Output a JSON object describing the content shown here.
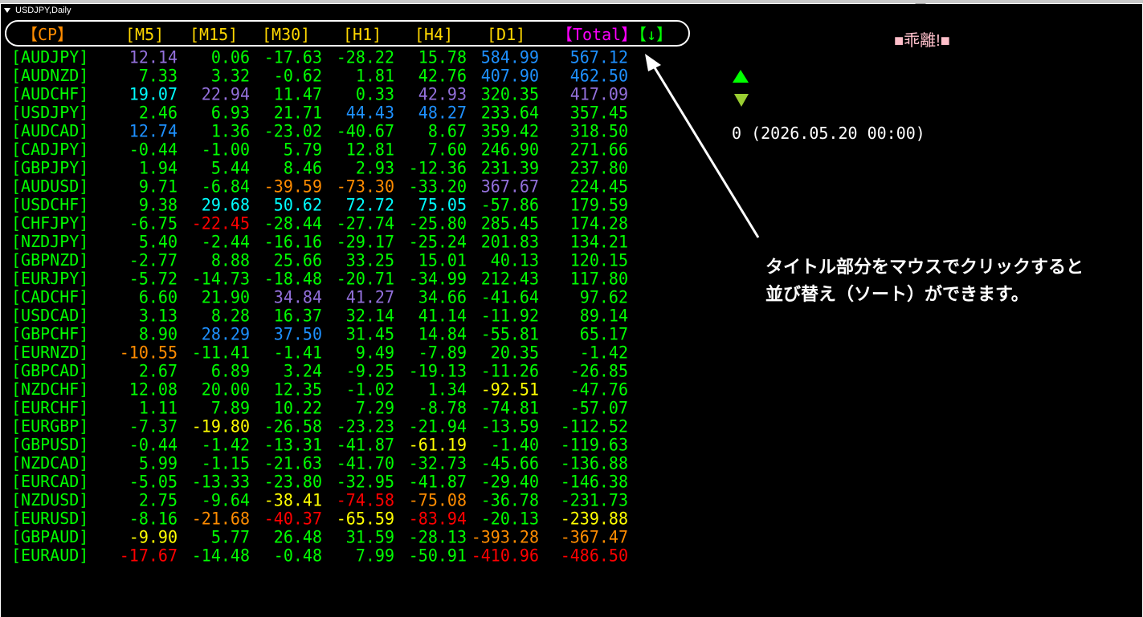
{
  "window_title": "USDJPY,Daily",
  "headers": [
    {
      "label": "【CP】",
      "color": "#ff8c00"
    },
    {
      "label": "[M5]",
      "color": "#ffd700"
    },
    {
      "label": "[M15]",
      "color": "#ffd700"
    },
    {
      "label": "[M30]",
      "color": "#ffd700"
    },
    {
      "label": "[H1]",
      "color": "#ffd700"
    },
    {
      "label": "[H4]",
      "color": "#ffd700"
    },
    {
      "label": "[D1]",
      "color": "#ffd700"
    },
    {
      "label": "【Total】",
      "color": "#ff00ff"
    },
    {
      "label": "【↓】",
      "color": "#00ff00"
    }
  ],
  "kairi_label": "■乖離!■",
  "status_text": "0 (2026.05.20 00:00)",
  "annotation": {
    "line1": "タイトル部分をマウスでクリックすると",
    "line2": "並び替え（ソート）ができます。"
  },
  "colors": {
    "pair": "#00ff00",
    "normal": "#00ff00",
    "purple": "#9370db",
    "cyan": "#1e90ff",
    "aqua": "#00ffff",
    "orange": "#ff8c00",
    "yellow": "#ffff00",
    "red": "#ff0000",
    "lightblue": "#87cefa"
  },
  "rows": [
    {
      "pair": "[AUDJPY]",
      "v": [
        "12.14",
        "0.06",
        "-17.63",
        "-28.22",
        "15.78",
        "584.99",
        "567.12"
      ],
      "c": [
        "purple",
        "normal",
        "normal",
        "normal",
        "normal",
        "cyan",
        "cyan"
      ]
    },
    {
      "pair": "[AUDNZD]",
      "v": [
        "7.33",
        "3.32",
        "-0.62",
        "1.81",
        "42.76",
        "407.90",
        "462.50"
      ],
      "c": [
        "normal",
        "normal",
        "normal",
        "normal",
        "normal",
        "cyan",
        "cyan"
      ]
    },
    {
      "pair": "[AUDCHF]",
      "v": [
        "19.07",
        "22.94",
        "11.47",
        "0.33",
        "42.93",
        "320.35",
        "417.09"
      ],
      "c": [
        "aqua",
        "purple",
        "normal",
        "normal",
        "purple",
        "normal",
        "purple"
      ]
    },
    {
      "pair": "[USDJPY]",
      "v": [
        "2.46",
        "6.93",
        "21.71",
        "44.43",
        "48.27",
        "233.64",
        "357.45"
      ],
      "c": [
        "normal",
        "normal",
        "normal",
        "cyan",
        "cyan",
        "normal",
        "normal"
      ]
    },
    {
      "pair": "[AUDCAD]",
      "v": [
        "12.74",
        "1.36",
        "-23.02",
        "-40.67",
        "8.67",
        "359.42",
        "318.50"
      ],
      "c": [
        "cyan",
        "normal",
        "normal",
        "normal",
        "normal",
        "normal",
        "normal"
      ]
    },
    {
      "pair": "[CADJPY]",
      "v": [
        "-0.44",
        "-1.00",
        "5.79",
        "12.81",
        "7.60",
        "246.90",
        "271.66"
      ],
      "c": [
        "normal",
        "normal",
        "normal",
        "normal",
        "normal",
        "normal",
        "normal"
      ]
    },
    {
      "pair": "[GBPJPY]",
      "v": [
        "1.94",
        "5.44",
        "8.46",
        "2.93",
        "-12.36",
        "231.39",
        "237.80"
      ],
      "c": [
        "normal",
        "normal",
        "normal",
        "normal",
        "normal",
        "normal",
        "normal"
      ]
    },
    {
      "pair": "[AUDUSD]",
      "v": [
        "9.71",
        "-6.84",
        "-39.59",
        "-73.30",
        "-33.20",
        "367.67",
        "224.45"
      ],
      "c": [
        "normal",
        "normal",
        "orange",
        "orange",
        "normal",
        "purple",
        "normal"
      ]
    },
    {
      "pair": "[USDCHF]",
      "v": [
        "9.38",
        "29.68",
        "50.62",
        "72.72",
        "75.05",
        "-57.86",
        "179.59"
      ],
      "c": [
        "normal",
        "aqua",
        "aqua",
        "aqua",
        "aqua",
        "normal",
        "normal"
      ]
    },
    {
      "pair": "[CHFJPY]",
      "v": [
        "-6.75",
        "-22.45",
        "-28.44",
        "-27.74",
        "-25.80",
        "285.45",
        "174.28"
      ],
      "c": [
        "normal",
        "red",
        "normal",
        "normal",
        "normal",
        "normal",
        "normal"
      ]
    },
    {
      "pair": "[NZDJPY]",
      "v": [
        "5.40",
        "-2.44",
        "-16.16",
        "-29.17",
        "-25.24",
        "201.83",
        "134.21"
      ],
      "c": [
        "normal",
        "normal",
        "normal",
        "normal",
        "normal",
        "normal",
        "normal"
      ]
    },
    {
      "pair": "[GBPNZD]",
      "v": [
        "-2.77",
        "8.88",
        "25.66",
        "33.25",
        "15.01",
        "40.13",
        "120.15"
      ],
      "c": [
        "normal",
        "normal",
        "normal",
        "normal",
        "normal",
        "normal",
        "normal"
      ]
    },
    {
      "pair": "[EURJPY]",
      "v": [
        "-5.72",
        "-14.73",
        "-18.48",
        "-20.71",
        "-34.99",
        "212.43",
        "117.80"
      ],
      "c": [
        "normal",
        "normal",
        "normal",
        "normal",
        "normal",
        "normal",
        "normal"
      ]
    },
    {
      "pair": "[CADCHF]",
      "v": [
        "6.60",
        "21.90",
        "34.84",
        "41.27",
        "34.66",
        "-41.64",
        "97.62"
      ],
      "c": [
        "normal",
        "normal",
        "purple",
        "purple",
        "normal",
        "normal",
        "normal"
      ]
    },
    {
      "pair": "[USDCAD]",
      "v": [
        "3.13",
        "8.28",
        "16.37",
        "32.14",
        "41.14",
        "-11.92",
        "89.14"
      ],
      "c": [
        "normal",
        "normal",
        "normal",
        "normal",
        "normal",
        "normal",
        "normal"
      ]
    },
    {
      "pair": "[GBPCHF]",
      "v": [
        "8.90",
        "28.29",
        "37.50",
        "31.45",
        "14.84",
        "-55.81",
        "65.17"
      ],
      "c": [
        "normal",
        "cyan",
        "cyan",
        "normal",
        "normal",
        "normal",
        "normal"
      ]
    },
    {
      "pair": "[EURNZD]",
      "v": [
        "-10.55",
        "-11.41",
        "-1.41",
        "9.49",
        "-7.89",
        "20.35",
        "-1.42"
      ],
      "c": [
        "orange",
        "normal",
        "normal",
        "normal",
        "normal",
        "normal",
        "normal"
      ]
    },
    {
      "pair": "[GBPCAD]",
      "v": [
        "2.67",
        "6.89",
        "3.24",
        "-9.25",
        "-19.13",
        "-11.26",
        "-26.85"
      ],
      "c": [
        "normal",
        "normal",
        "normal",
        "normal",
        "normal",
        "normal",
        "normal"
      ]
    },
    {
      "pair": "[NZDCHF]",
      "v": [
        "12.08",
        "20.00",
        "12.35",
        "-1.02",
        "1.34",
        "-92.51",
        "-47.76"
      ],
      "c": [
        "normal",
        "normal",
        "normal",
        "normal",
        "normal",
        "yellow",
        "normal"
      ]
    },
    {
      "pair": "[EURCHF]",
      "v": [
        "1.11",
        "7.89",
        "10.22",
        "7.29",
        "-8.78",
        "-74.81",
        "-57.07"
      ],
      "c": [
        "normal",
        "normal",
        "normal",
        "normal",
        "normal",
        "normal",
        "normal"
      ]
    },
    {
      "pair": "[EURGBP]",
      "v": [
        "-7.37",
        "-19.80",
        "-26.58",
        "-23.23",
        "-21.94",
        "-13.59",
        "-112.52"
      ],
      "c": [
        "normal",
        "yellow",
        "normal",
        "normal",
        "normal",
        "normal",
        "normal"
      ]
    },
    {
      "pair": "[GBPUSD]",
      "v": [
        "-0.44",
        "-1.42",
        "-13.31",
        "-41.87",
        "-61.19",
        "-1.40",
        "-119.63"
      ],
      "c": [
        "normal",
        "normal",
        "normal",
        "normal",
        "yellow",
        "normal",
        "normal"
      ]
    },
    {
      "pair": "[NZDCAD]",
      "v": [
        "5.99",
        "-1.15",
        "-21.63",
        "-41.70",
        "-32.73",
        "-45.66",
        "-136.88"
      ],
      "c": [
        "normal",
        "normal",
        "normal",
        "normal",
        "normal",
        "normal",
        "normal"
      ]
    },
    {
      "pair": "[EURCAD]",
      "v": [
        "-5.05",
        "-13.33",
        "-23.80",
        "-32.95",
        "-41.87",
        "-29.40",
        "-146.38"
      ],
      "c": [
        "normal",
        "normal",
        "normal",
        "normal",
        "normal",
        "normal",
        "normal"
      ]
    },
    {
      "pair": "[NZDUSD]",
      "v": [
        "2.75",
        "-9.64",
        "-38.41",
        "-74.58",
        "-75.08",
        "-36.78",
        "-231.73"
      ],
      "c": [
        "normal",
        "normal",
        "yellow",
        "red",
        "orange",
        "normal",
        "normal"
      ]
    },
    {
      "pair": "[EURUSD]",
      "v": [
        "-8.16",
        "-21.68",
        "-40.37",
        "-65.59",
        "-83.94",
        "-20.13",
        "-239.88"
      ],
      "c": [
        "normal",
        "orange",
        "red",
        "yellow",
        "red",
        "normal",
        "yellow"
      ]
    },
    {
      "pair": "[GBPAUD]",
      "v": [
        "-9.90",
        "5.77",
        "26.48",
        "31.59",
        "-28.13",
        "-393.28",
        "-367.47"
      ],
      "c": [
        "yellow",
        "normal",
        "normal",
        "normal",
        "normal",
        "orange",
        "orange"
      ]
    },
    {
      "pair": "[EURAUD]",
      "v": [
        "-17.67",
        "-14.48",
        "-0.48",
        "7.99",
        "-50.91",
        "-410.96",
        "-486.50"
      ],
      "c": [
        "red",
        "normal",
        "normal",
        "normal",
        "normal",
        "red",
        "red"
      ]
    }
  ]
}
